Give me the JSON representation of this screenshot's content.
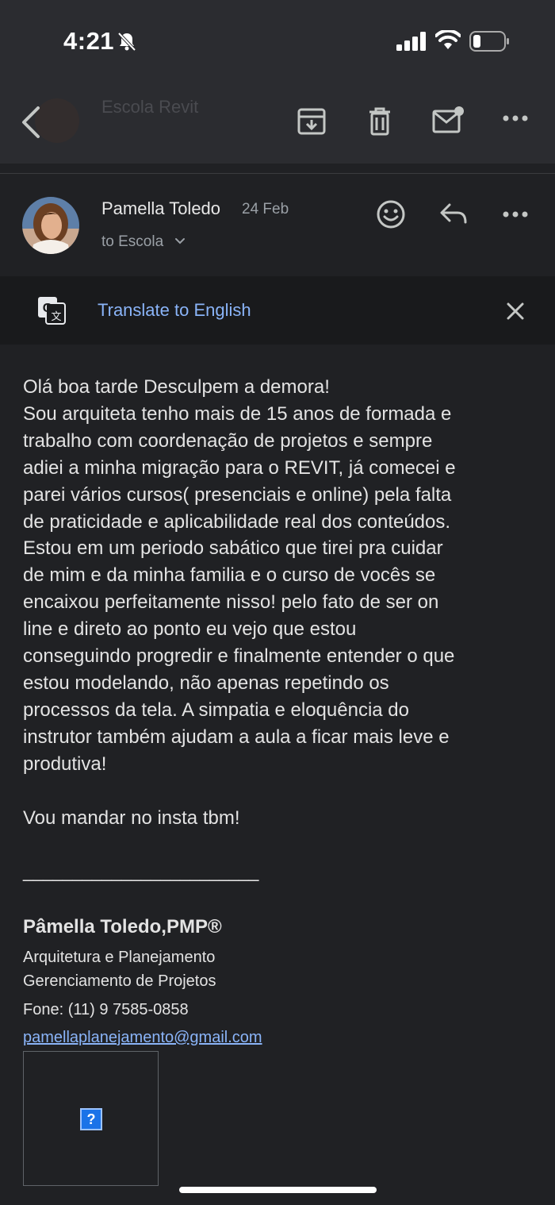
{
  "status_bar": {
    "time": "4:21",
    "icons": [
      "bell-slash-icon",
      "signal-icon",
      "wifi-icon",
      "battery-icon"
    ]
  },
  "toolbar": {
    "faded_sender": "Escola Revit",
    "icons": [
      "back-arrow-icon",
      "archive-icon",
      "trash-icon",
      "mark-unread-icon",
      "more-vert-icon"
    ]
  },
  "sender": {
    "name": "Pamella Toledo",
    "date": "24 Feb",
    "to": "to Escola",
    "icons": [
      "emoji-icon",
      "reply-icon",
      "more-icon"
    ]
  },
  "translate": {
    "link": "Translate to English",
    "icons": [
      "google-translate-icon",
      "close-icon"
    ]
  },
  "message": {
    "lines": [
      "Olá boa tarde Desculpem a demora!",
      "Sou arquiteta tenho mais de 15 anos de formada e",
      "trabalho com coordenação de projetos e sempre",
      "adiei a minha migração para o REVIT, já comecei e",
      "parei vários cursos( presenciais e online) pela falta",
      "de praticidade e aplicabilidade real dos conteúdos.",
      "Estou em um periodo sabático que tirei pra cuidar",
      "de mim e da minha familia e o curso de vocês se",
      "encaixou perfeitamente nisso! pelo fato de ser on",
      "line e direto ao ponto eu vejo que estou",
      "conseguindo progredir e finalmente entender o que",
      "estou modelando, não apenas repetindo os",
      "processos da tela. A simpatia e eloquência do",
      "instrutor também ajudam a aula a ficar mais leve e",
      "produtiva!"
    ],
    "closing": "Vou mandar no insta tbm!"
  },
  "signature": {
    "separator": "________________________",
    "name": "Pâmella Toledo,PMP®",
    "line1": "Arquitetura e Planejamento",
    "line2": "Gerenciamento de Projetos",
    "phone": "Fone: (11) 9 7585-0858",
    "email": "pamellaplanejamento@gmail.com",
    "broken_image": "?"
  },
  "colors": {
    "background": "#202124",
    "link": "#8ab4f8",
    "text": "#e3e3e3"
  }
}
